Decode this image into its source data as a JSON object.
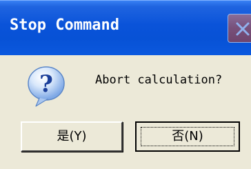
{
  "window": {
    "title": "Stop Command",
    "titlebar_color": "#0752d6"
  },
  "icons": {
    "close": "close-icon",
    "question": "question-icon"
  },
  "dialog": {
    "message": "Abort calculation?"
  },
  "buttons": {
    "yes_label": "是(Y)",
    "no_label": "否(N)",
    "focused": "no"
  }
}
